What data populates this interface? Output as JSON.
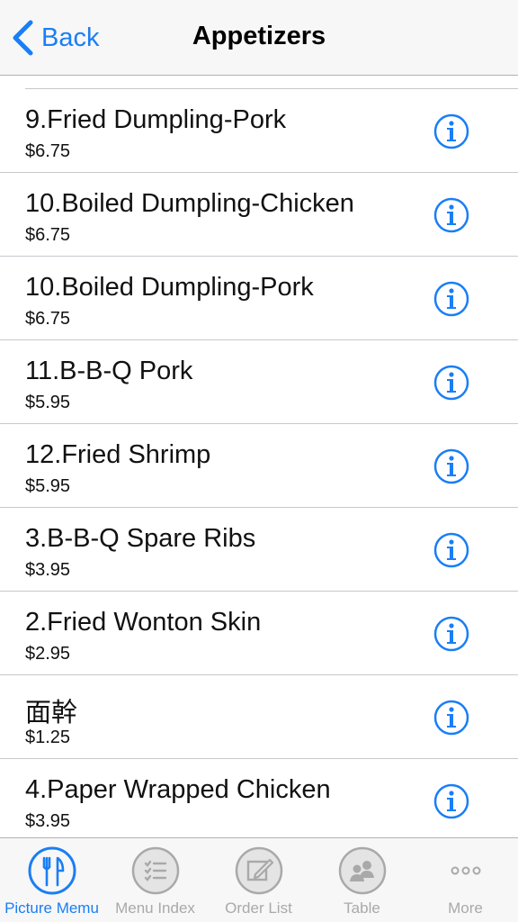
{
  "nav": {
    "back_label": "Back",
    "title": "Appetizers"
  },
  "accent_color": "#1a7ef5",
  "items": [
    {
      "name": "9.Fried Dumpling-Pork",
      "price": "$6.75"
    },
    {
      "name": "10.Boiled Dumpling-Chicken",
      "price": "$6.75"
    },
    {
      "name": "10.Boiled Dumpling-Pork",
      "price": "$6.75"
    },
    {
      "name": "11.B-B-Q Pork",
      "price": "$5.95"
    },
    {
      "name": "12.Fried Shrimp",
      "price": "$5.95"
    },
    {
      "name": "3.B-B-Q Spare Ribs",
      "price": "$3.95"
    },
    {
      "name": "2.Fried Wonton Skin",
      "price": "$2.95"
    },
    {
      "name": "面幹",
      "price": "$1.25"
    },
    {
      "name": "4.Paper Wrapped Chicken",
      "price": "$3.95"
    }
  ],
  "tabs": [
    {
      "label": "Picture Memu",
      "icon": "fork-knife-icon",
      "active": true
    },
    {
      "label": "Menu Index",
      "icon": "list-icon",
      "active": false
    },
    {
      "label": "Order List",
      "icon": "edit-icon",
      "active": false
    },
    {
      "label": "Table",
      "icon": "people-icon",
      "active": false
    },
    {
      "label": "More",
      "icon": "more-icon",
      "active": false
    }
  ]
}
